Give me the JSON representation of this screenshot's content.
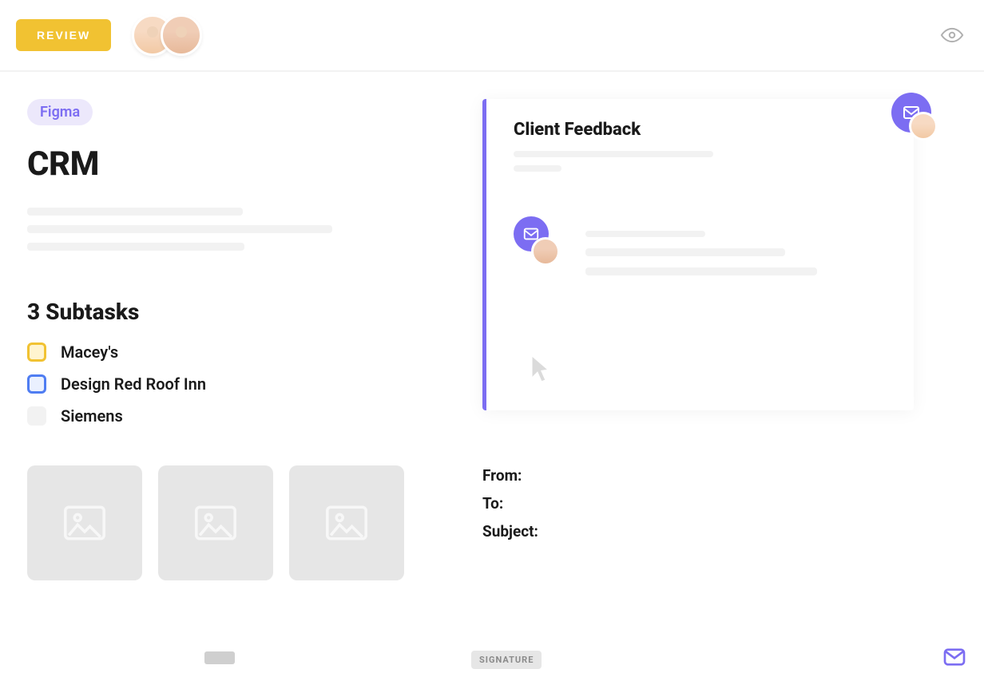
{
  "header": {
    "review_label": "REVIEW"
  },
  "left": {
    "chip": "Figma",
    "title": "CRM",
    "subtasks_heading": "3 Subtasks",
    "subtasks": [
      {
        "label": "Macey's",
        "color": "yellow"
      },
      {
        "label": "Design Red Roof Inn",
        "color": "blue"
      },
      {
        "label": "Siemens",
        "color": "gray"
      }
    ]
  },
  "feedback": {
    "title": "Client Feedback"
  },
  "compose": {
    "from_label": "From:",
    "to_label": "To:",
    "subject_label": "Subject:"
  },
  "footer": {
    "signature_label": "SIGNATURE"
  }
}
